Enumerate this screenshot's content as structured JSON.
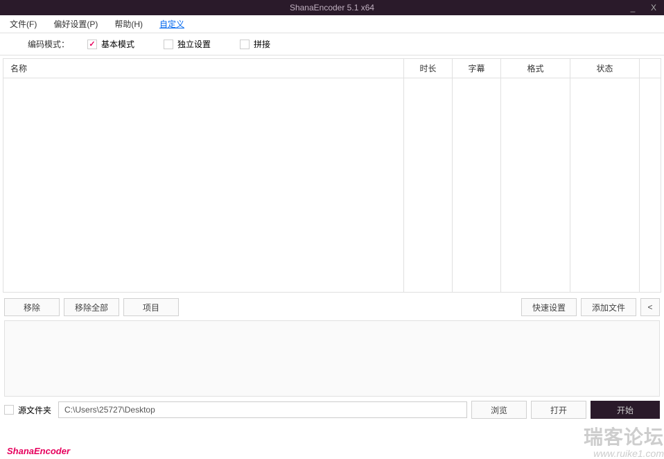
{
  "window": {
    "title": "ShanaEncoder 5.1 x64",
    "minimize": "_",
    "close": "X"
  },
  "menu": {
    "file": "文件(F)",
    "preferences": "偏好设置(P)",
    "help": "帮助(H)",
    "custom": "自定义"
  },
  "encoding": {
    "label": "编码模式：",
    "basic": "基本模式",
    "independent": "独立设置",
    "concat": "拼接"
  },
  "table": {
    "headers": {
      "name": "名称",
      "duration": "时长",
      "subtitle": "字幕",
      "format": "格式",
      "status": "状态"
    }
  },
  "buttons": {
    "remove": "移除",
    "removeAll": "移除全部",
    "project": "项目",
    "quickSettings": "快速设置",
    "addFile": "添加文件",
    "collapse": "<",
    "browse": "浏览",
    "open": "打开",
    "start": "开始"
  },
  "bottom": {
    "sourceFolder": "源文件夹",
    "path": "C:\\Users\\25727\\Desktop"
  },
  "brand": "ShanaEncoder",
  "watermark": {
    "line1": "瑞客论坛",
    "line2": "www.ruike1.com"
  }
}
